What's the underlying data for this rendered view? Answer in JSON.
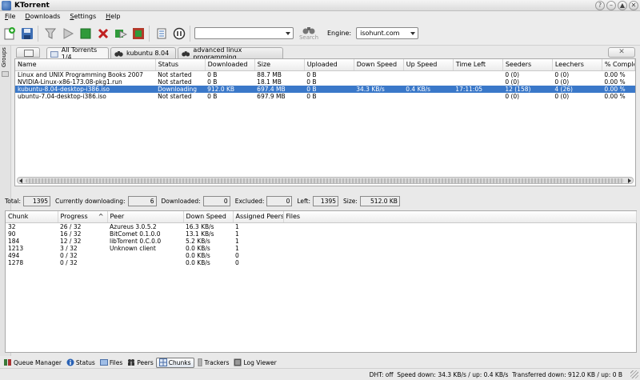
{
  "window": {
    "title": "KTorrent"
  },
  "menu": [
    "File",
    "Downloads",
    "Settings",
    "Help"
  ],
  "toolbar": {
    "search_placeholder": "",
    "search_label": "Search",
    "engine_label": "Engine:",
    "engine_value": "isohunt.com"
  },
  "groups": {
    "label": "Groups"
  },
  "tabs": [
    {
      "label": "All Torrents 1/4",
      "icon": "folder-icon"
    },
    {
      "label": "kubuntu 8.04",
      "icon": "binoculars-icon"
    },
    {
      "label": "advanced linux programming",
      "icon": "binoculars-icon"
    }
  ],
  "torrents": {
    "columns": [
      "Name",
      "Status",
      "Downloaded",
      "Size",
      "Uploaded",
      "Down Speed",
      "Up Speed",
      "Time Left",
      "Seeders",
      "Leechers",
      "% Complete"
    ],
    "rows": [
      {
        "name": "Linux and UNIX Programming Books 2007",
        "status": "Not started",
        "downloaded": "0 B",
        "size": "88.7 MB",
        "uploaded": "0 B",
        "down_speed": "",
        "up_speed": "",
        "time_left": "",
        "seeders": "0 (0)",
        "leechers": "0 (0)",
        "complete": "0.00 %"
      },
      {
        "name": "NVIDIA-Linux-x86-173.08-pkg1.run",
        "status": "Not started",
        "downloaded": "0 B",
        "size": "18.1 MB",
        "uploaded": "0 B",
        "down_speed": "",
        "up_speed": "",
        "time_left": "",
        "seeders": "0 (0)",
        "leechers": "0 (0)",
        "complete": "0.00 %"
      },
      {
        "name": "kubuntu-8.04-desktop-i386.iso",
        "status": "Downloading",
        "downloaded": "912.0 KB",
        "size": "697.4 MB",
        "uploaded": "0 B",
        "down_speed": "34.3 KB/s",
        "up_speed": "0.4 KB/s",
        "time_left": "17:11:05",
        "seeders": "12 (158)",
        "leechers": "4 (26)",
        "complete": "0.00 %"
      },
      {
        "name": "ubuntu-7.04-desktop-i386.iso",
        "status": "Not started",
        "downloaded": "0 B",
        "size": "697.9 MB",
        "uploaded": "0 B",
        "down_speed": "",
        "up_speed": "",
        "time_left": "",
        "seeders": "0 (0)",
        "leechers": "0 (0)",
        "complete": "0.00 %"
      }
    ]
  },
  "stats": {
    "total_label": "Total:",
    "total": "1395",
    "downloading_label": "Currently downloading:",
    "downloading": "6",
    "downloaded_label": "Downloaded:",
    "downloaded": "0",
    "excluded_label": "Excluded:",
    "excluded": "0",
    "left_label": "Left:",
    "left": "1395",
    "size_label": "Size:",
    "size": "512.0 KB"
  },
  "chunks": {
    "columns": [
      "Chunk",
      "Progress",
      "Peer",
      "Down Speed",
      "Assigned Peers",
      "Files"
    ],
    "rows": [
      {
        "chunk": "32",
        "progress": "26 / 32",
        "peer": "Azureus 3.0.5.2",
        "speed": "16.3 KB/s",
        "assigned": "1"
      },
      {
        "chunk": "90",
        "progress": "16 / 32",
        "peer": "BitComet 0.1.0.0",
        "speed": "13.1 KB/s",
        "assigned": "1"
      },
      {
        "chunk": "184",
        "progress": "12 / 32",
        "peer": "libTorrent 0.C.0.0",
        "speed": "5.2 KB/s",
        "assigned": "1"
      },
      {
        "chunk": "1213",
        "progress": "3 / 32",
        "peer": "Unknown client",
        "speed": "0.0 KB/s",
        "assigned": "1"
      },
      {
        "chunk": "494",
        "progress": "0 / 32",
        "peer": "",
        "speed": "0.0 KB/s",
        "assigned": "0"
      },
      {
        "chunk": "1278",
        "progress": "0 / 32",
        "peer": "",
        "speed": "0.0 KB/s",
        "assigned": "0"
      }
    ]
  },
  "bottom_tabs": [
    "Queue Manager",
    "Status",
    "Files",
    "Peers",
    "Chunks",
    "Trackers",
    "Log Viewer"
  ],
  "statusbar": {
    "text": "DHT: off  Speed down: 34.3 KB/s / up: 0.4 KB/s  Transferred down: 912.0 KB / up: 0 B"
  }
}
